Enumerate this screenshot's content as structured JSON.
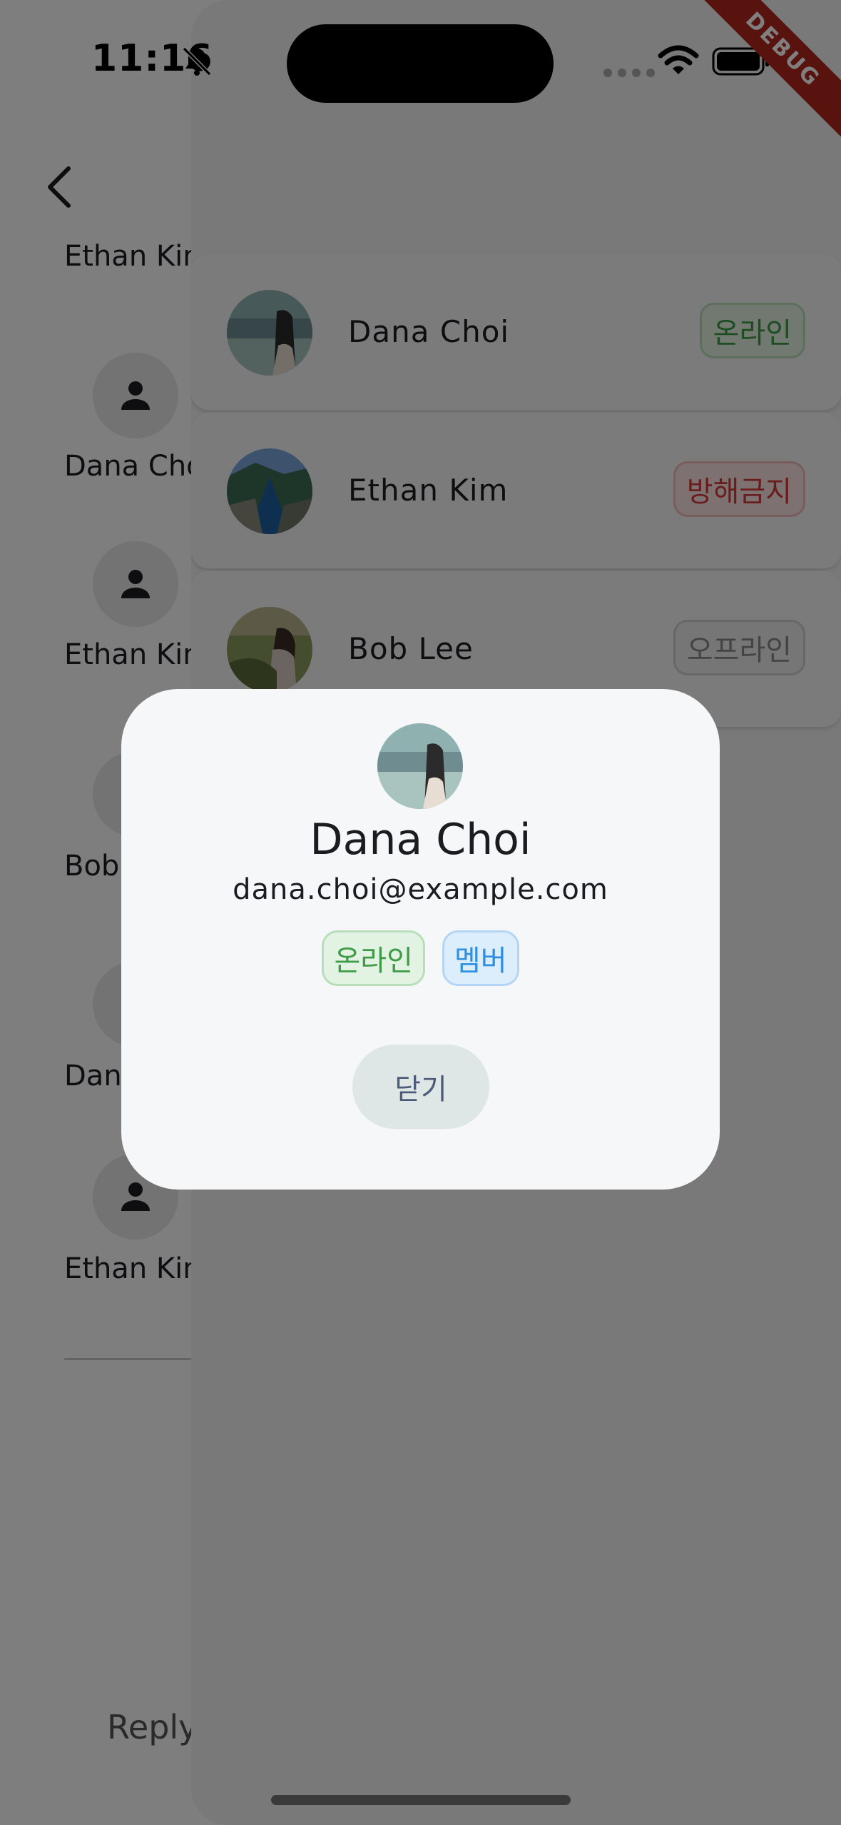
{
  "status_bar": {
    "time": "11:16"
  },
  "debug_banner": "DEBUG",
  "thread": {
    "top_name": "Ethan Kim",
    "entries": [
      {
        "name": "Dana Choi",
        "avatar_icon": "person-icon"
      },
      {
        "name": "Ethan Kim",
        "avatar_icon": "person-icon"
      },
      {
        "name": "Bob Lee",
        "avatar_icon": "person-icon"
      },
      {
        "name": "Dana Choi",
        "avatar_icon": "person-icon"
      },
      {
        "name": "Ethan Kim",
        "avatar_icon": "person-icon"
      }
    ],
    "reply_placeholder": "Reply"
  },
  "members": [
    {
      "name": "Dana Choi",
      "status": "온라인",
      "status_kind": "online"
    },
    {
      "name": "Ethan Kim",
      "status": "방해금지",
      "status_kind": "dnd"
    },
    {
      "name": "Bob Lee",
      "status": "오프라인",
      "status_kind": "offline"
    }
  ],
  "dialog": {
    "name": "Dana Choi",
    "email": "dana.choi@example.com",
    "status_chip": "온라인",
    "role_chip": "멤버",
    "close_label": "닫기"
  },
  "colors": {
    "online": "#3f9b46",
    "dnd": "#d33b3b",
    "offline": "#888888",
    "member": "#2f8fe0"
  }
}
